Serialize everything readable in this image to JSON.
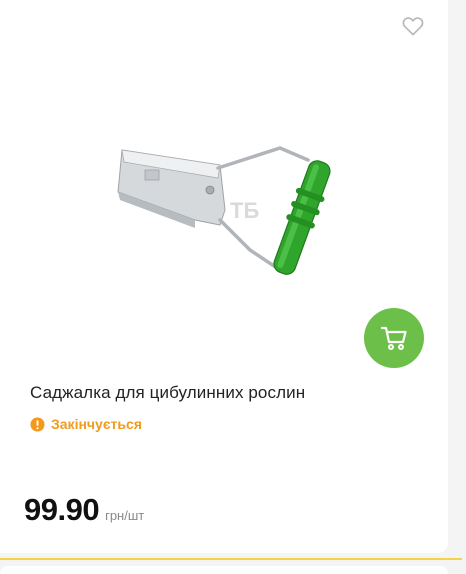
{
  "product": {
    "title": "Саджалка для цибулинних рослин",
    "status": "Закінчується",
    "price": "99.90",
    "unit": "грн/шт",
    "watermark": "TБ"
  },
  "colors": {
    "accent_green": "#6cc04a",
    "status_orange": "#f39a1c",
    "divider_yellow": "#f2d34a"
  },
  "icons": {
    "wishlist": "heart-outline-icon",
    "cart": "cart-icon",
    "status": "warning-icon"
  }
}
